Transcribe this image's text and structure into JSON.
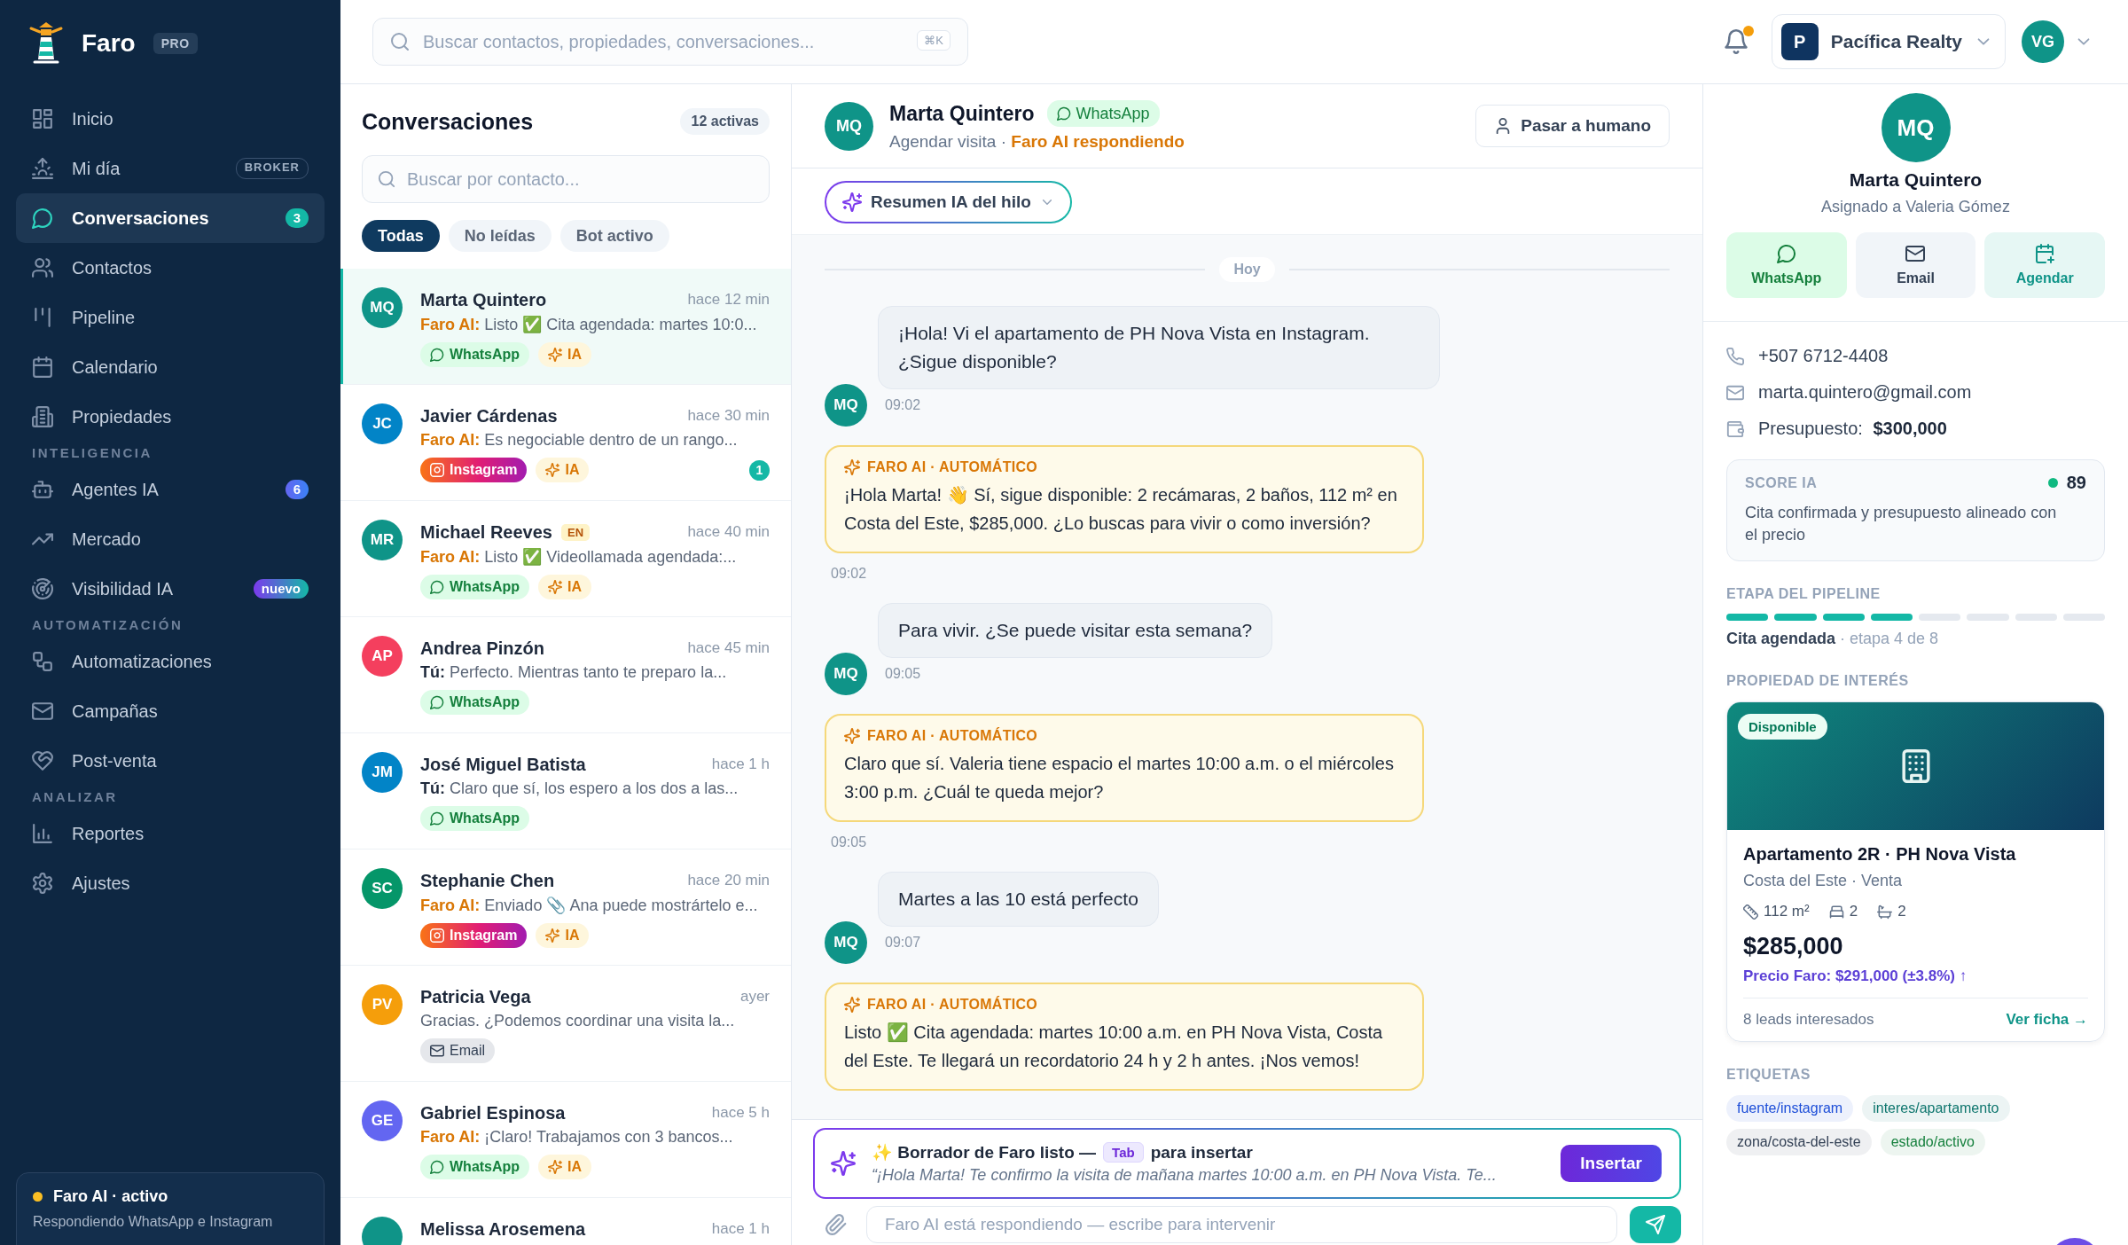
{
  "sidebar": {
    "brand": {
      "name": "Faro",
      "plan": "PRO"
    },
    "sections": [
      {
        "items": [
          {
            "label": "Inicio",
            "selected": false
          },
          {
            "label": "Mi día",
            "selected": false,
            "badge": {
              "kind": "tag",
              "text": "BROKER"
            }
          },
          {
            "label": "Conversaciones",
            "selected": true,
            "badge": {
              "kind": "count",
              "text": "3"
            }
          },
          {
            "label": "Contactos",
            "selected": false
          },
          {
            "label": "Pipeline",
            "selected": false
          },
          {
            "label": "Calendario",
            "selected": false
          },
          {
            "label": "Propiedades",
            "selected": false
          }
        ]
      },
      {
        "title": "INTELIGENCIA",
        "items": [
          {
            "label": "Agentes IA",
            "selected": false,
            "badge": {
              "kind": "ai-count",
              "text": "6"
            }
          },
          {
            "label": "Mercado",
            "selected": false
          },
          {
            "label": "Visibilidad IA",
            "selected": false,
            "badge": {
              "kind": "new",
              "text": "nuevo"
            }
          }
        ]
      },
      {
        "title": "AUTOMATIZACIÓN",
        "items": [
          {
            "label": "Automatizaciones",
            "selected": false
          },
          {
            "label": "Campañas",
            "selected": false
          },
          {
            "label": "Post-venta",
            "selected": false
          }
        ]
      },
      {
        "title": "ANALIZAR",
        "items": [
          {
            "label": "Reportes",
            "selected": false
          },
          {
            "label": "Ajustes",
            "selected": false
          }
        ]
      }
    ],
    "status": {
      "active": true,
      "title": "Faro AI · activo",
      "detail": "Respondiendo WhatsApp e Instagram"
    }
  },
  "topbar": {
    "search": {
      "placeholder": "Buscar contactos, propiedades, conversaciones...",
      "shortcut": "⌘K"
    },
    "notifications": {
      "unread": true
    },
    "workspace": {
      "initial": "P",
      "name": "Pacífica Realty"
    },
    "user": {
      "initials": "VG"
    }
  },
  "conversations": {
    "title": "Conversaciones",
    "count": "12 activas",
    "search": {
      "placeholder": "Buscar por contacto..."
    },
    "filters": [
      {
        "label": "Todas",
        "selected": true
      },
      {
        "label": "No leídas",
        "selected": false
      },
      {
        "label": "Bot activo",
        "selected": false
      }
    ],
    "items": [
      {
        "initials": "MQ",
        "color": "#0f9488",
        "name": "Marta Quintero",
        "time": "hace 12 min",
        "preview": {
          "kind": "ai",
          "text": "**Faro AI:** Listo ✅ Cita agendada: martes 10:0..."
        },
        "channels": [
          {
            "kind": "whatsapp",
            "label": "WhatsApp"
          },
          {
            "kind": "ai",
            "label": "IA"
          }
        ],
        "selected": true
      },
      {
        "initials": "JC",
        "color": "#0284c7",
        "name": "Javier Cárdenas",
        "time": "hace 30 min",
        "preview": {
          "kind": "ai",
          "text": "**Faro AI:** Es negociable dentro de un rango..."
        },
        "channels": [
          {
            "kind": "instagram",
            "label": "Instagram"
          },
          {
            "kind": "ai",
            "label": "IA"
          }
        ],
        "unread": "1",
        "selected": false
      },
      {
        "initials": "MR",
        "color": "#0f9488",
        "name": "Michael Reeves",
        "language": "EN",
        "time": "hace 40 min",
        "preview": {
          "kind": "ai",
          "text": "**Faro AI:** Listo ✅ Videollamada agendada:..."
        },
        "channels": [
          {
            "kind": "whatsapp",
            "label": "WhatsApp"
          },
          {
            "kind": "ai",
            "label": "IA"
          }
        ],
        "selected": false
      },
      {
        "initials": "AP",
        "color": "#f43f5e",
        "name": "Andrea Pinzón",
        "time": "hace 45 min",
        "preview": {
          "kind": "agent",
          "text": "**Tú:** Perfecto. Mientras tanto te preparo la..."
        },
        "channels": [
          {
            "kind": "whatsapp",
            "label": "WhatsApp"
          }
        ],
        "selected": false
      },
      {
        "initials": "JM",
        "color": "#0284c7",
        "name": "José Miguel Batista",
        "time": "hace 1 h",
        "preview": {
          "kind": "agent",
          "text": "**Tú:** Claro que sí, los espero a los dos a las..."
        },
        "channels": [
          {
            "kind": "whatsapp",
            "label": "WhatsApp"
          }
        ],
        "selected": false
      },
      {
        "initials": "SC",
        "color": "#059669",
        "name": "Stephanie Chen",
        "time": "hace 20 min",
        "preview": {
          "kind": "ai",
          "text": "**Faro AI:** Enviado 📎 Ana puede mostrártelo e..."
        },
        "channels": [
          {
            "kind": "instagram",
            "label": "Instagram"
          },
          {
            "kind": "ai",
            "label": "IA"
          }
        ],
        "selected": false
      },
      {
        "initials": "PV",
        "color": "#f59e0b",
        "name": "Patricia Vega",
        "time": "ayer",
        "preview": {
          "text": "Gracias. ¿Podemos coordinar una visita la..."
        },
        "channels": [
          {
            "kind": "email",
            "label": "Email"
          }
        ],
        "selected": false
      },
      {
        "initials": "GE",
        "color": "#6366f1",
        "name": "Gabriel Espinosa",
        "time": "hace 5 h",
        "preview": {
          "kind": "ai",
          "text": "**Faro AI:** ¡Claro! Trabajamos con 3 bancos..."
        },
        "channels": [
          {
            "kind": "whatsapp",
            "label": "WhatsApp"
          },
          {
            "kind": "ai",
            "label": "IA"
          }
        ],
        "selected": false
      },
      {
        "color": "#0f9488",
        "name": "Melissa Arosemena",
        "time": "hace 1 h",
        "selected": false
      }
    ]
  },
  "chat": {
    "header": {
      "initials": "MQ",
      "name": "Marta Quintero",
      "channel": "WhatsApp",
      "subtitle": "Agendar visita · **Faro AI respondiendo**",
      "handoff": "Pasar a humano"
    },
    "summary": "Resumen IA del hilo",
    "day": "Hoy",
    "messages": [
      {
        "kind": "incoming",
        "text": "¡Hola! Vi el apartamento de PH Nova Vista en Instagram. ¿Sigue disponible?",
        "initials": "MQ",
        "time": "09:02"
      },
      {
        "kind": "ai",
        "label": "FARO AI · AUTOMÁTICO",
        "text": "¡Hola Marta! 👋 Sí, sigue disponible: 2 recámaras, 2 baños, 112 m² en Costa del Este, $285,000. ¿Lo buscas para vivir o como inversión?",
        "time": "09:02"
      },
      {
        "kind": "incoming",
        "text": "Para vivir. ¿Se puede visitar esta semana?",
        "initials": "MQ",
        "time": "09:05"
      },
      {
        "kind": "ai",
        "label": "FARO AI · AUTOMÁTICO",
        "text": "Claro que sí. Valeria tiene espacio el martes 10:00 a.m. o el miércoles 3:00 p.m. ¿Cuál te queda mejor?",
        "time": "09:05"
      },
      {
        "kind": "incoming",
        "text": "Martes a las 10 está perfecto",
        "initials": "MQ",
        "time": "09:07"
      },
      {
        "kind": "ai",
        "label": "FARO AI · AUTOMÁTICO",
        "text": "Listo ✅ Cita agendada: martes 10:00 a.m. en PH Nova Vista, Costa del Este. Te llegará un recordatorio 24 h y 2 h antes. ¡Nos vemos!"
      }
    ],
    "draft": {
      "title": "✨ Borrador de Faro listo —",
      "key": "Tab",
      "hint": "para insertar",
      "text": "“¡Hola Marta! Te confirmo la visita de mañana martes 10:00 a.m. en PH Nova Vista. Te...",
      "button": "Insertar"
    },
    "composer": {
      "placeholder": "Faro AI está respondiendo — escribe para intervenir"
    }
  },
  "contact_panel": {
    "initials": "MQ",
    "name": "Marta Quintero",
    "assigned": "Asignado a Valeria Gómez",
    "actions": [
      {
        "kind": "whatsapp",
        "label": "WhatsApp"
      },
      {
        "kind": "email",
        "label": "Email"
      },
      {
        "kind": "schedule",
        "label": "Agendar"
      }
    ],
    "details": [
      {
        "kind": "phone",
        "text": "+507 6712-4408"
      },
      {
        "kind": "email",
        "text": "marta.quintero@gmail.com"
      },
      {
        "kind": "budget",
        "text": "Presupuesto: **$300,000**"
      }
    ],
    "score": {
      "title": "SCORE IA",
      "value": "89",
      "note": "Cita confirmada y presupuesto alineado con el precio"
    },
    "pipeline": {
      "title": "ETAPA DEL PIPELINE",
      "segments": [
        {
          "done": true
        },
        {
          "done": true
        },
        {
          "done": true
        },
        {
          "done": true
        },
        {
          "done": false
        },
        {
          "done": false
        },
        {
          "done": false
        },
        {
          "done": false
        }
      ],
      "stage": "**Cita agendada** · etapa 4 de 8"
    },
    "property": {
      "title": "PROPIEDAD DE INTERÉS",
      "status": "Disponible",
      "name": "Apartamento 2R · PH Nova Vista",
      "location": "Costa del Este · Venta",
      "features": [
        {
          "kind": "area",
          "text": "112 m²"
        },
        {
          "kind": "bedrooms",
          "text": "2"
        },
        {
          "kind": "bathrooms",
          "text": "2"
        }
      ],
      "price": "$285,000",
      "estimate": "Precio Faro: $291,000 (±3.8%) ↑",
      "leads": "8 leads interesados",
      "link": "Ver ficha →"
    },
    "tags": {
      "title": "ETIQUETAS",
      "items": [
        {
          "label": "fuente/instagram",
          "color": "#1d4ed8"
        },
        {
          "label": "interes/apartamento",
          "color": "#0f766e"
        },
        {
          "label": "zona/costa-del-este",
          "color": "#334155"
        },
        {
          "label": "estado/activo",
          "color": "#15803d"
        }
      ]
    }
  }
}
